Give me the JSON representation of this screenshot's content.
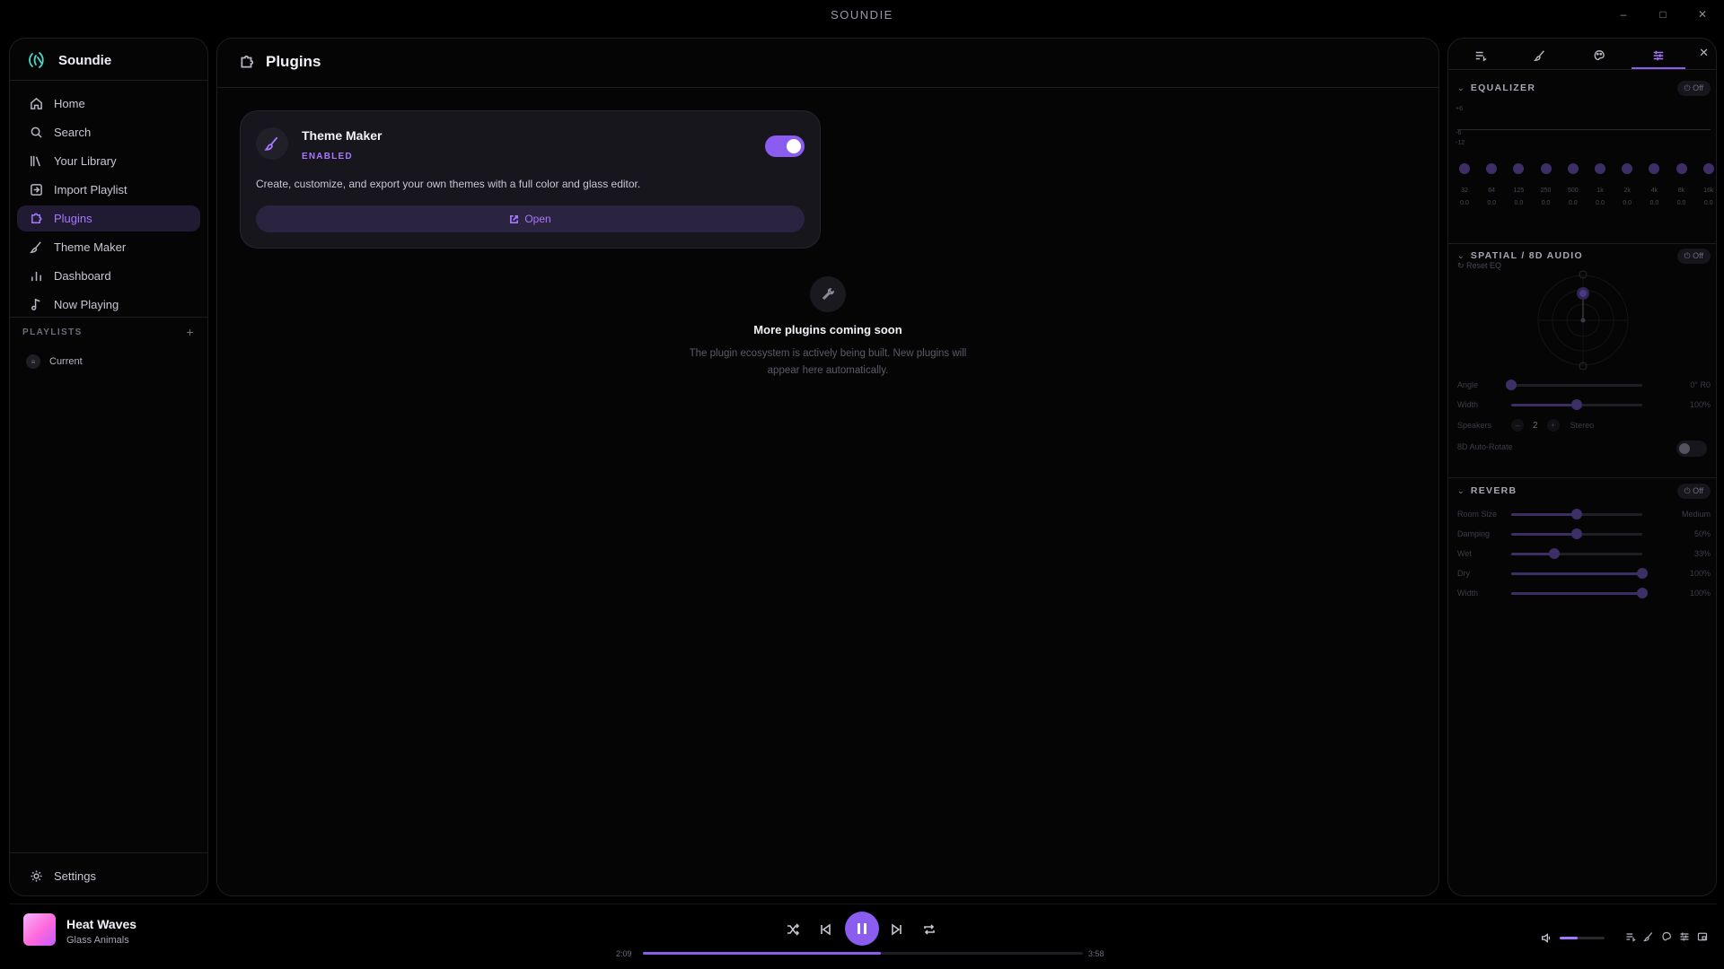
{
  "window": {
    "title": "SOUNDIE",
    "minimize": "–",
    "maximize": "□",
    "close": "✕"
  },
  "sidebar": {
    "app_name": "Soundie",
    "items": [
      {
        "label": "Home",
        "icon": "home-icon"
      },
      {
        "label": "Search",
        "icon": "search-icon"
      },
      {
        "label": "Your Library",
        "icon": "library-icon"
      },
      {
        "label": "Import Playlist",
        "icon": "import-icon"
      },
      {
        "label": "Plugins",
        "icon": "puzzle-icon",
        "active": true
      },
      {
        "label": "Theme Maker",
        "icon": "brush-icon"
      },
      {
        "label": "Dashboard",
        "icon": "bar-chart-icon"
      },
      {
        "label": "Now Playing",
        "icon": "music-note-icon"
      }
    ],
    "playlists_heading": "PLAYLISTS",
    "add_playlist": "+",
    "playlists": [
      {
        "label": "Current"
      }
    ],
    "settings_label": "Settings"
  },
  "main": {
    "title": "Plugins",
    "plugin": {
      "name": "Theme Maker",
      "status": "ENABLED",
      "enabled": true,
      "description": "Create, customize, and export your own themes with a full color and glass editor.",
      "open_label": "Open"
    },
    "empty_state": {
      "heading": "More plugins coming soon",
      "text": "The plugin ecosystem is actively being built. New plugins will appear here automatically."
    }
  },
  "right_panel": {
    "tabs": [
      "queue-icon",
      "brush-icon",
      "palette-icon",
      "sliders-icon"
    ],
    "active_tab": 3,
    "close": "✕",
    "equalizer": {
      "title": "EQUALIZER",
      "state": "Off",
      "scale": [
        "+6",
        "-6",
        "-12"
      ],
      "bands": [
        {
          "f": "32",
          "v": "0.0"
        },
        {
          "f": "64",
          "v": "0.0"
        },
        {
          "f": "125",
          "v": "0.0"
        },
        {
          "f": "250",
          "v": "0.0"
        },
        {
          "f": "500",
          "v": "0.0"
        },
        {
          "f": "1k",
          "v": "0.0"
        },
        {
          "f": "2k",
          "v": "0.0"
        },
        {
          "f": "4k",
          "v": "0.0"
        },
        {
          "f": "8k",
          "v": "0.0"
        },
        {
          "f": "16k",
          "v": "0.0"
        }
      ],
      "reset_label": "Reset EQ"
    },
    "spatial": {
      "title": "SPATIAL / 8D AUDIO",
      "state": "Off",
      "angle_label": "Angle",
      "angle_value": "0° R0",
      "angle_level": 0,
      "width_label": "Width",
      "width_value": "100%",
      "width_level": 0.5,
      "speakers_label": "Speakers",
      "speakers_value": "2",
      "speakers_mode": "Stereo",
      "auto_rotate_label": "8D Auto-Rotate"
    },
    "reverb": {
      "title": "REVERB",
      "state": "Off",
      "rows": [
        {
          "label": "Room Size",
          "value": "Medium",
          "level": 0.5
        },
        {
          "label": "Damping",
          "value": "50%",
          "level": 0.5
        },
        {
          "label": "Wet",
          "value": "33%",
          "level": 0.33
        },
        {
          "label": "Dry",
          "value": "100%",
          "level": 1.0
        },
        {
          "label": "Width",
          "value": "100%",
          "level": 1.0
        }
      ]
    }
  },
  "player": {
    "song": "Heat Waves",
    "artist": "Glass Animals",
    "elapsed": "2:09",
    "duration": "3:58",
    "progress": 0.54,
    "volume": 0.4
  },
  "colors": {
    "accent": "#8a5cf0",
    "accent_text": "#a777ff",
    "panel": "#050505"
  }
}
